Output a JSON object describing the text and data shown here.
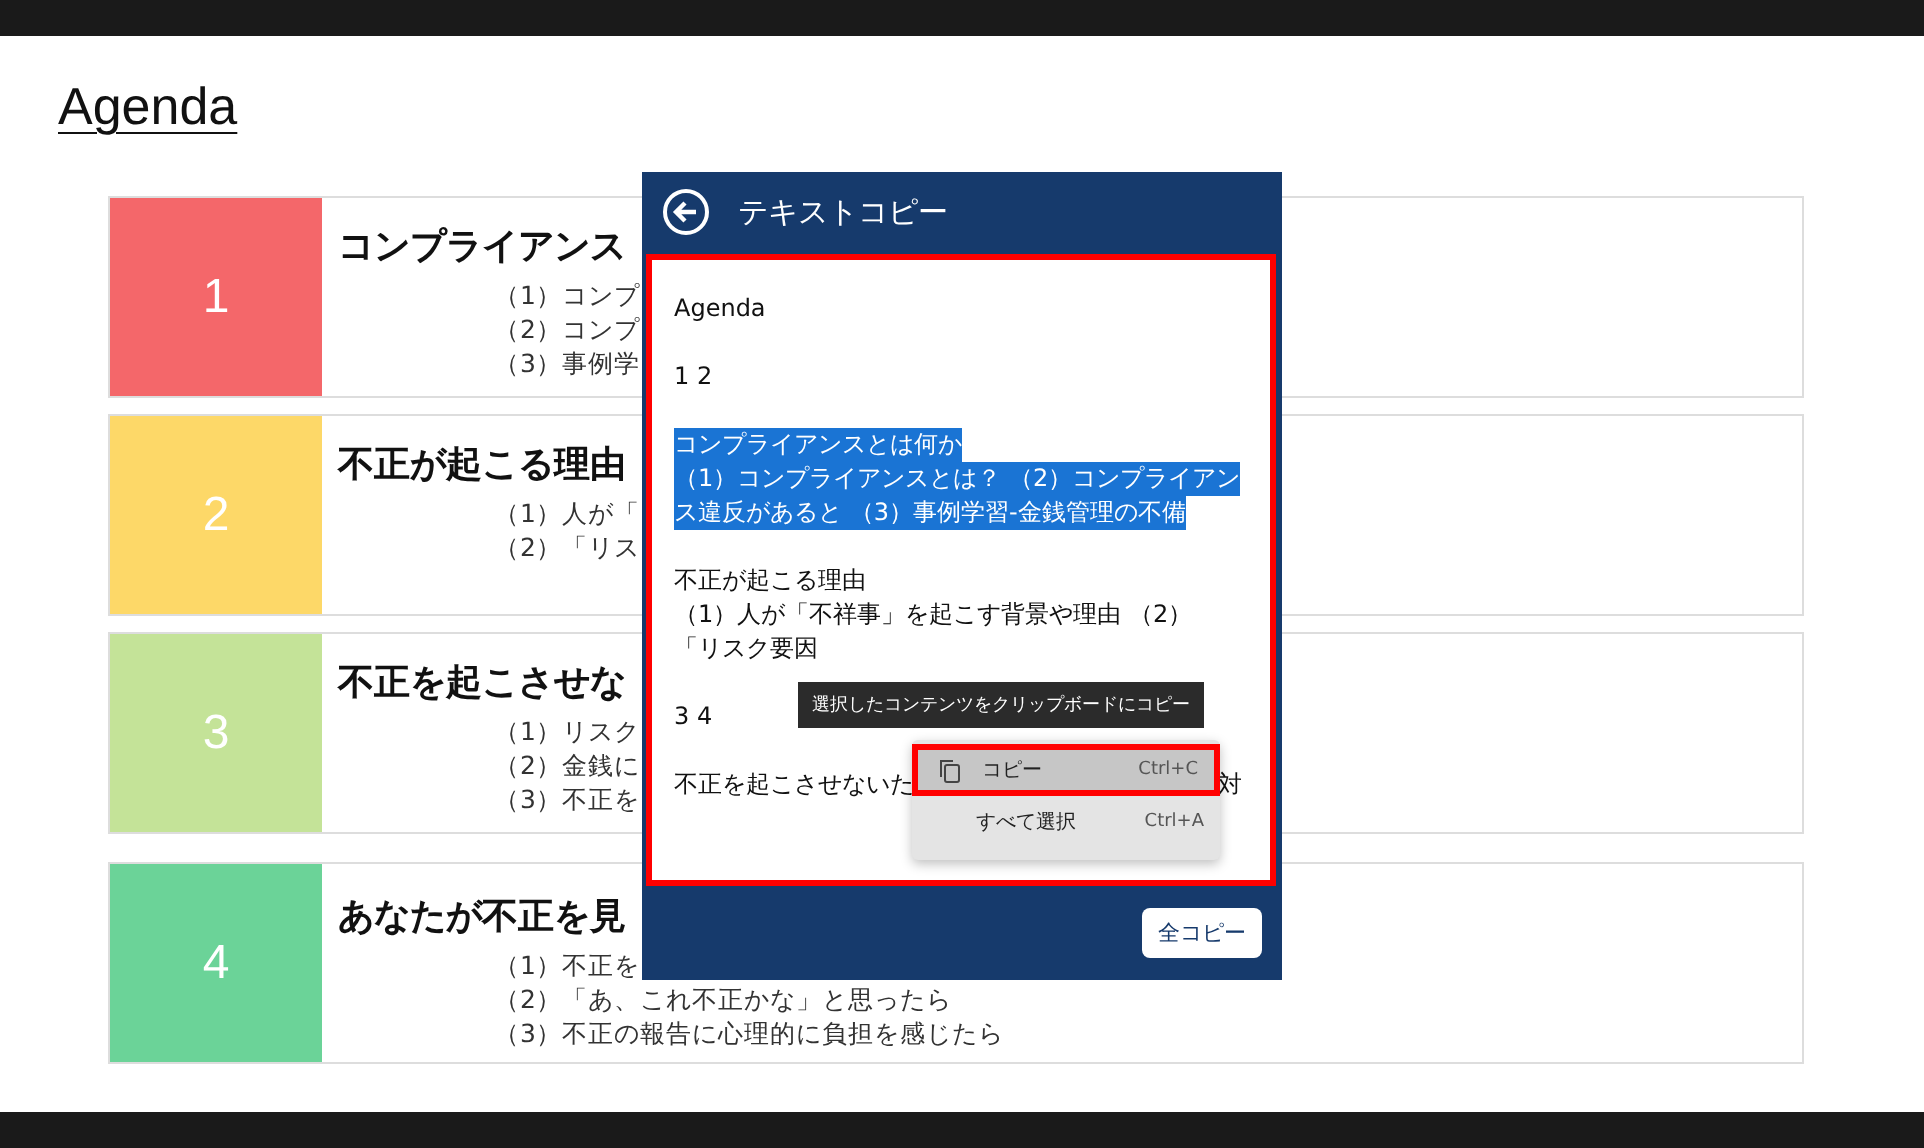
{
  "slide": {
    "title": "Agenda",
    "rows": [
      {
        "number": "1",
        "color": "#f4676a",
        "heading": "コンプライアンス",
        "items": [
          "（1）コンプ",
          "（2）コンプ",
          "（3）事例学"
        ]
      },
      {
        "number": "2",
        "color": "#fdd868",
        "heading": "不正が起こる理由",
        "items": [
          "（1）人が「",
          "（2）「リス"
        ]
      },
      {
        "number": "3",
        "color": "#c4e398",
        "heading": "不正を起こさせな",
        "items": [
          "（1）リスク",
          "（2）金銭に",
          "（3）不正を"
        ]
      },
      {
        "number": "4",
        "color": "#6bd398",
        "heading": "あなたが不正を見",
        "items": [
          "（1）不正を",
          "（2）「あ、これ不正かな」と思ったら",
          "（3）不正の報告に心理的に負担を感じたら"
        ]
      }
    ]
  },
  "panel": {
    "title": "テキストコピー",
    "paragraphs": [
      {
        "selected": false,
        "lines": [
          "Agenda"
        ]
      },
      {
        "selected": false,
        "lines": [
          "1 2"
        ]
      },
      {
        "selected": true,
        "lines": [
          "コンプライアンスとは何か",
          "（1）コンプライアンスとは？ （2）コンプライアン",
          "ス違反があると （3）事例学習-金銭管理の不備"
        ]
      },
      {
        "selected": false,
        "lines": [
          "不正が起こる理由",
          "（1）人が「不祥事」を起こす背景や理由 （2）",
          "「リスク要因"
        ]
      },
      {
        "selected": false,
        "lines": [
          "3 4"
        ]
      },
      {
        "selected": false,
        "lines": [
          "不正を起こさせないた"
        ],
        "trailing": "対"
      }
    ],
    "tooltip": "選択したコンテンツをクリップボードにコピー",
    "menu": [
      {
        "label": "コピー",
        "shortcut": "Ctrl+C",
        "selected": true,
        "icon": true
      },
      {
        "label": "すべて選択",
        "shortcut": "Ctrl+A",
        "selected": false,
        "icon": false
      }
    ],
    "copy_all_button": "全コピー"
  }
}
